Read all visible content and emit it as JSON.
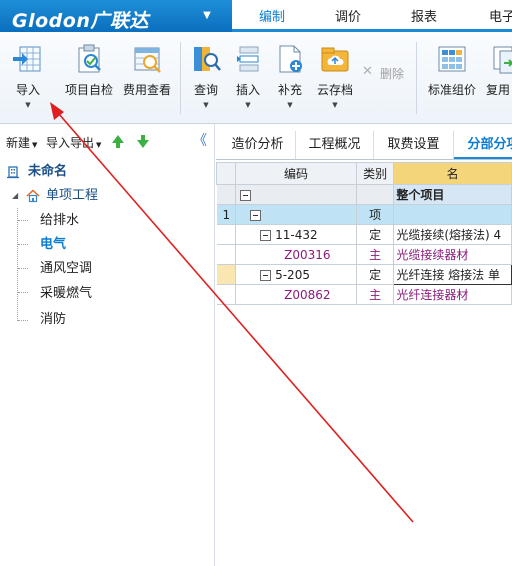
{
  "app": {
    "logo": "Glodon广联达",
    "accent": "#1b8ad6"
  },
  "menu": {
    "tabs": [
      "编制",
      "调价",
      "报表",
      "电子"
    ],
    "active": "编制"
  },
  "ribbon": {
    "buttons": [
      {
        "label": "导入",
        "icon": "import-icon",
        "dropdown": true
      },
      {
        "label": "项目自检",
        "icon": "project-check-icon"
      },
      {
        "label": "费用查看",
        "icon": "cost-view-icon"
      },
      {
        "label": "查询",
        "icon": "query-icon",
        "dropdown": true
      },
      {
        "label": "插入",
        "icon": "insert-icon",
        "dropdown": true
      },
      {
        "label": "补充",
        "icon": "supplement-icon",
        "dropdown": true
      },
      {
        "label": "云存档",
        "icon": "cloud-archive-icon",
        "dropdown": true
      },
      {
        "label": "删除",
        "icon": "delete-icon",
        "disabled": true
      },
      {
        "label": "标准组价",
        "icon": "standard-pricing-icon"
      },
      {
        "label": "复用",
        "icon": "reuse-icon"
      }
    ]
  },
  "left": {
    "toolbar": {
      "new_label": "新建",
      "import_export_label": "导入导出",
      "collapse_symbol": "《"
    },
    "tree": {
      "root": "未命名",
      "project": "单项工程",
      "items": [
        "给排水",
        "电气",
        "通风空调",
        "采暖燃气",
        "消防"
      ],
      "selected": "电气"
    }
  },
  "right": {
    "tabs": [
      "造价分析",
      "工程概况",
      "取费设置",
      "分部分项"
    ],
    "active_tab": "分部分项",
    "grid": {
      "headers": {
        "code": "编码",
        "type": "类别",
        "name": "名"
      },
      "rows": [
        {
          "num": "",
          "code": "",
          "type": "",
          "name": "整个项目"
        },
        {
          "num": "1",
          "code": "",
          "type": "项",
          "name": ""
        },
        {
          "num": "",
          "code": "11-432",
          "type": "定",
          "name": "光缆接续(熔接法) 4"
        },
        {
          "num": "",
          "code": "Z00316",
          "type": "主",
          "name": "光缆接续器材"
        },
        {
          "num": "",
          "code": "5-205",
          "type": "定",
          "name": "光纤连接 熔接法 单"
        },
        {
          "num": "",
          "code": "Z00862",
          "type": "主",
          "name": "光纤连接器材"
        }
      ]
    }
  },
  "annotation": {
    "arrow_color": "#e02020"
  }
}
